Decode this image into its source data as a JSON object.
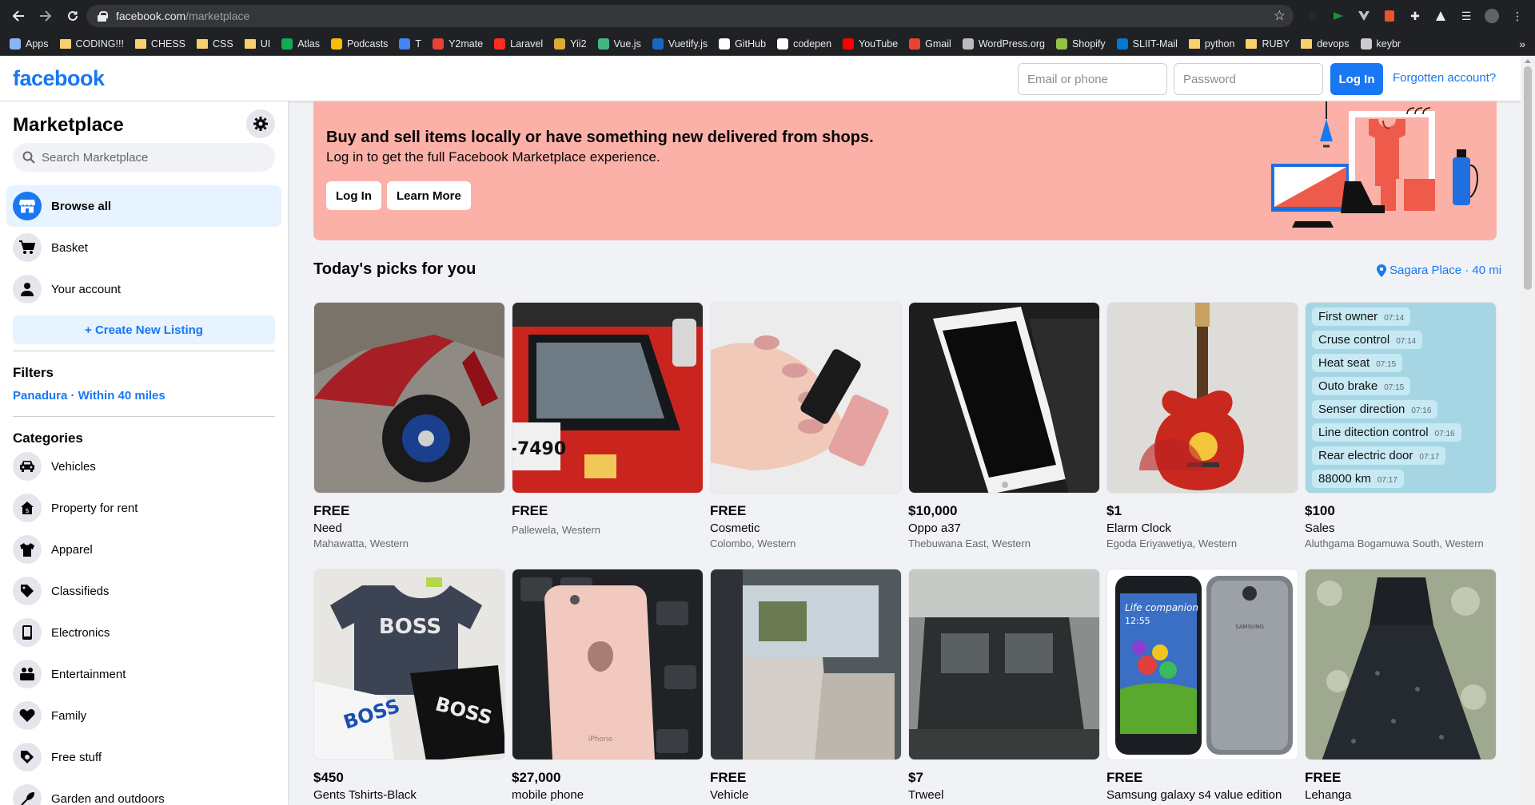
{
  "browser": {
    "url_host": "facebook.com",
    "url_path": "/marketplace",
    "bookmarks": [
      {
        "label": "Apps",
        "icon": "apps-grid-icon",
        "color": "#8ab4f8"
      },
      {
        "label": "CODING!!!",
        "icon": "folder-icon",
        "color": "#f9d06b"
      },
      {
        "label": "CHESS",
        "icon": "folder-icon",
        "color": "#f9d06b"
      },
      {
        "label": "CSS",
        "icon": "folder-icon",
        "color": "#f9d06b"
      },
      {
        "label": "UI",
        "icon": "folder-icon",
        "color": "#f9d06b"
      },
      {
        "label": "Atlas",
        "icon": "leaf-icon",
        "color": "#13aa52"
      },
      {
        "label": "Podcasts",
        "icon": "podcasts-icon",
        "color": "#fbbc04"
      },
      {
        "label": "T",
        "icon": "translate-icon",
        "color": "#4285f4"
      },
      {
        "label": "Y2mate",
        "icon": "download-icon",
        "color": "#ea4335"
      },
      {
        "label": "Laravel",
        "icon": "laravel-icon",
        "color": "#ff2d20"
      },
      {
        "label": "Yii2",
        "icon": "yii-icon",
        "color": "#ddaa33"
      },
      {
        "label": "Vue.js",
        "icon": "vue-icon",
        "color": "#41b883"
      },
      {
        "label": "Vuetify.js",
        "icon": "vuetify-icon",
        "color": "#1867c0"
      },
      {
        "label": "GitHub",
        "icon": "github-icon",
        "color": "#ffffff"
      },
      {
        "label": "codepen",
        "icon": "codepen-icon",
        "color": "#ffffff"
      },
      {
        "label": "YouTube",
        "icon": "youtube-icon",
        "color": "#ff0000"
      },
      {
        "label": "Gmail",
        "icon": "gmail-icon",
        "color": "#ea4335"
      },
      {
        "label": "WordPress.org",
        "icon": "wordpress-icon",
        "color": "#bbbbbb"
      },
      {
        "label": "Shopify",
        "icon": "shopify-icon",
        "color": "#95bf47"
      },
      {
        "label": "SLIIT-Mail",
        "icon": "outlook-icon",
        "color": "#0078d4"
      },
      {
        "label": "python",
        "icon": "folder-icon",
        "color": "#f9d06b"
      },
      {
        "label": "RUBY",
        "icon": "folder-icon",
        "color": "#f9d06b"
      },
      {
        "label": "devops",
        "icon": "folder-icon",
        "color": "#f9d06b"
      },
      {
        "label": "keybr",
        "icon": "keyboard-icon",
        "color": "#cccccc"
      }
    ],
    "bookmarks_more": "»"
  },
  "header": {
    "logo": "facebook",
    "email_placeholder": "Email or phone",
    "password_placeholder": "Password",
    "login_label": "Log In",
    "forgot_label": "Forgotten account?"
  },
  "sidebar": {
    "title": "Marketplace",
    "search_placeholder": "Search Marketplace",
    "nav": [
      {
        "label": "Browse all",
        "icon": "storefront-icon",
        "active": true
      },
      {
        "label": "Basket",
        "icon": "cart-icon",
        "active": false
      },
      {
        "label": "Your account",
        "icon": "person-icon",
        "active": false
      }
    ],
    "create_listing": "+ Create New Listing",
    "filters_heading": "Filters",
    "filter_value": "Panadura · Within 40 miles",
    "categories_heading": "Categories",
    "categories": [
      {
        "label": "Vehicles",
        "icon": "car-icon"
      },
      {
        "label": "Property for rent",
        "icon": "house-icon"
      },
      {
        "label": "Apparel",
        "icon": "shirt-icon"
      },
      {
        "label": "Classifieds",
        "icon": "tag-icon"
      },
      {
        "label": "Electronics",
        "icon": "phone-icon"
      },
      {
        "label": "Entertainment",
        "icon": "people-icon"
      },
      {
        "label": "Family",
        "icon": "heart-icon"
      },
      {
        "label": "Free stuff",
        "icon": "free-tag-icon"
      },
      {
        "label": "Garden and outdoors",
        "icon": "garden-icon"
      }
    ]
  },
  "banner": {
    "title": "Buy and sell items locally or have something new delivered from shops.",
    "subtitle": "Log in to get the full Facebook Marketplace experience.",
    "login_label": "Log In",
    "learn_more_label": "Learn More",
    "bg_color": "#fcb1a8"
  },
  "main": {
    "picks_title": "Today's picks for you",
    "location": "Sagara Place · 40 mi",
    "listings": [
      {
        "price": "FREE",
        "title": "Need",
        "location": "Mahawatta, Western",
        "image": "red-scooter-wheel"
      },
      {
        "price": "FREE",
        "title": "",
        "location": "Pallewela, Western",
        "image": "red-three-wheeler"
      },
      {
        "price": "FREE",
        "title": "Cosmetic",
        "location": "Colombo, Western",
        "image": "nail-polish-hand"
      },
      {
        "price": "$10,000",
        "title": "Oppo a37",
        "location": "Thebuwana East, Western",
        "image": "white-smartphone"
      },
      {
        "price": "$1",
        "title": "Elarm Clock",
        "location": "Egoda Eriyawetiya, Western",
        "image": "guitar-clock"
      },
      {
        "price": "$100",
        "title": "Sales",
        "location": "Aluthgama Bogamuwa South, Western",
        "image": "chat-screenshot"
      },
      {
        "price": "$450",
        "title": "Gents Tshirts-Black",
        "location": "",
        "image": "boss-tshirts"
      },
      {
        "price": "$27,000",
        "title": "mobile phone",
        "location": "",
        "image": "rose-gold-iphone"
      },
      {
        "price": "FREE",
        "title": "Vehicle",
        "location": "",
        "image": "van-interior"
      },
      {
        "price": "$7",
        "title": "Trweel",
        "location": "",
        "image": "dark-vehicle"
      },
      {
        "price": "FREE",
        "title": "Samsung galaxy s4 value edition",
        "location": "",
        "image": "samsung-s4"
      },
      {
        "price": "FREE",
        "title": "Lehanga",
        "location": "",
        "image": "black-lehanga"
      }
    ],
    "chat_lines": [
      {
        "text": "First owner",
        "time": "07:14"
      },
      {
        "text": "Cruse control",
        "time": "07:14"
      },
      {
        "text": "Heat seat",
        "time": "07:15"
      },
      {
        "text": "Outo brake",
        "time": "07:15"
      },
      {
        "text": "Senser direction",
        "time": "07:16"
      },
      {
        "text": "Line  ditection control",
        "time": "07:16"
      },
      {
        "text": "Rear electric door",
        "time": "07:17"
      },
      {
        "text": "88000 km",
        "time": "07:17"
      }
    ],
    "tshirt_text": "BOSS",
    "samsung_text_1": "Life companion",
    "samsung_text_2": "12:55",
    "samsung_brand": "SAMSUNG",
    "iphone_text": "iPhone",
    "tuk_plate": "-7490"
  }
}
